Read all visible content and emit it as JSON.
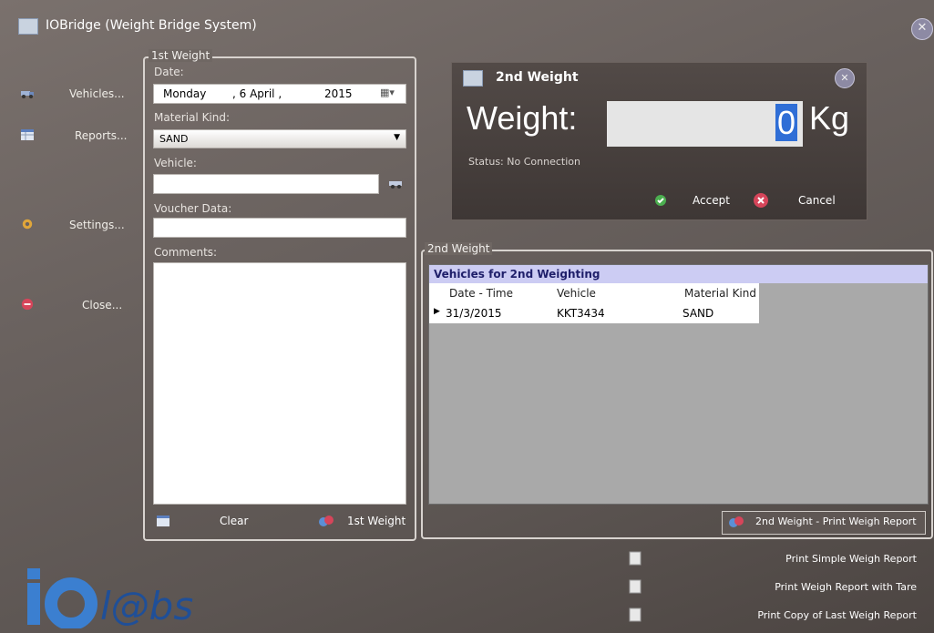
{
  "window": {
    "title": "IOBridge (Weight Bridge System)",
    "close_glyph": "✕"
  },
  "sidebar": {
    "items": [
      {
        "label": "Vehicles...",
        "icon": "truck-icon"
      },
      {
        "label": "Reports...",
        "icon": "table-icon"
      },
      {
        "label": "Settings...",
        "icon": "gear-icon"
      },
      {
        "label": "Close...",
        "icon": "close-circle-icon"
      }
    ]
  },
  "first_weight": {
    "legend": "1st Weight",
    "date_label": "Date:",
    "date_day": "Monday",
    "date_dm": ", 6  April  ,",
    "date_year": "2015",
    "material_label": "Material Kind:",
    "material_value": "SAND",
    "vehicle_label": "Vehicle:",
    "vehicle_value": "",
    "voucher_label": "Voucher Data:",
    "voucher_value": "",
    "comments_label": "Comments:",
    "comments_value": "",
    "clear_label": "Clear",
    "first_weight_button": "1st Weight"
  },
  "second_weight_dialog": {
    "title": "2nd Weight",
    "weight_label": "Weight:",
    "weight_value": "0",
    "unit": "Kg",
    "status": "Status: No Connection",
    "accept_label": "Accept",
    "cancel_label": "Cancel"
  },
  "second_weight": {
    "legend": "2nd Weight",
    "grid_title": "Vehicles for 2nd Weighting",
    "columns": [
      "Date - Time",
      "Vehicle",
      "Material Kind"
    ],
    "rows": [
      {
        "date": "31/3/2015",
        "vehicle": "KKT3434",
        "material": "SAND"
      }
    ],
    "print_button": "2nd Weight - Print Weigh Report"
  },
  "footer": {
    "links": [
      "Print Simple Weigh Report",
      "Print Weigh Report with Tare",
      "Print Copy of Last Weigh Report"
    ],
    "logo": "IO@bs"
  },
  "colors": {
    "accent_blue": "#2a6bd4",
    "grid_header": "#ccccf3",
    "accept_green": "#4caf50",
    "cancel_red": "#d6455a"
  }
}
